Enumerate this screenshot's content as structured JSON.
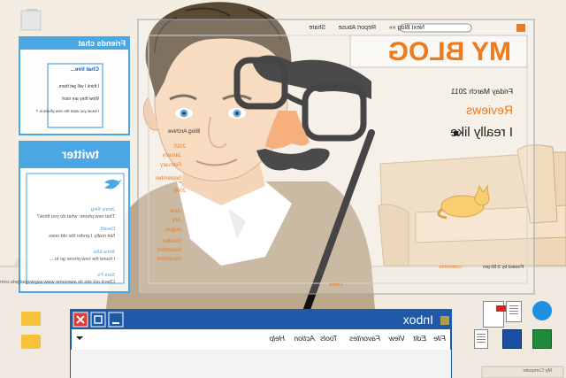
{
  "blog": {
    "share": "Share",
    "report_abuse": "Report Abuse",
    "next_blog": "Next Blog »»",
    "title": "MY BLOG",
    "date": "Friday March 2011",
    "reviews": "Reviews",
    "i_really_like": "I really like",
    "archive_title": "Blog Archive",
    "archive_items": [
      "2010",
      "January",
      "February",
      "September",
      "2009",
      "June",
      "July",
      "August",
      "October",
      "November",
      "December"
    ],
    "posted_by": "Posted by 3:50 pm",
    "comments": "comments",
    "home": "Home"
  },
  "friends_chat": {
    "title": "Friends chat",
    "chat_title": "Chat live...",
    "messages": [
      "I think I will get them.",
      "Wow they are nice!",
      "I know you want the new phone is ?"
    ]
  },
  "twitter": {
    "logo": "twitter",
    "tweets": [
      {
        "user": "Jenny King",
        "text": "That new phone: what do you think?"
      },
      {
        "user": "David1",
        "text": "Not really. I prefer the old ones"
      },
      {
        "user": "Anna Ellis",
        "text": "I found the new phone go to ..."
      },
      {
        "user": "Sara Ps",
        "text": "Check out site its awesome www.waywogadgets.com"
      }
    ]
  },
  "inbox": {
    "title": "Inbox",
    "menu": [
      "File",
      "Edit",
      "View",
      "Favorites",
      "Tools",
      "Action",
      "Help"
    ]
  },
  "taskbar": {
    "label": "My Computer"
  },
  "icons": {
    "window_controls": [
      "close-icon",
      "restore-icon",
      "minimize-icon"
    ],
    "desktop": [
      "pdf-file-icon",
      "document-icon",
      "internet-explorer-icon",
      "spreadsheet-icon",
      "word-icon",
      "text-file-icon",
      "folder-icon",
      "folder-icon"
    ]
  },
  "colors": {
    "accent_blue": "#1e5aa8",
    "twitter_blue": "#4aa7e4",
    "blog_orange": "#ee7a1e",
    "sweater": "#bda78a",
    "sofa": "#ecd6b6"
  }
}
